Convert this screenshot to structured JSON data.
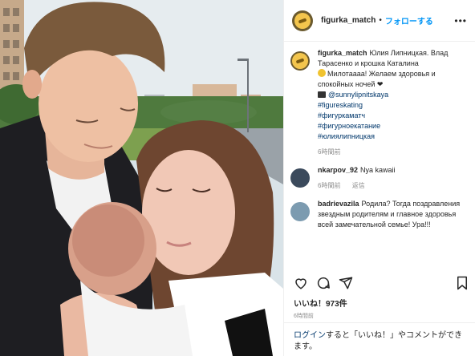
{
  "post": {
    "username": "figurka_match",
    "separator": "•",
    "follow_label": "フォローする",
    "more_label": "•••"
  },
  "caption": {
    "username": "figurka_match",
    "line1": "Юлия Липницкая. Влад Тарасенко и крошка Каталина",
    "line2": "Милотаааа! Желаем здоровья и спокойных ночей ❤",
    "mention": "@sunnylipnitskaya",
    "hashtags": [
      "#figureskating",
      "#фигуркаматч",
      "#фигурноекатание",
      "#юлиялипницкая"
    ],
    "time": "6時間前"
  },
  "comments": [
    {
      "username": "nkarpov_92",
      "text": "Nya kawaii",
      "time": "6時間前",
      "reply_label": "返信",
      "avatar_color": "#3b4a5c"
    },
    {
      "username": "badrievazila",
      "text": "Родила? Тогда поздравления звездным родителям и главное здоровья всей замечательной семье! Ура!!!",
      "avatar_color": "#7c9bb0"
    }
  ],
  "actions": {
    "like_icon": "heart-icon",
    "comment_icon": "comment-icon",
    "share_icon": "share-icon",
    "save_icon": "bookmark-icon"
  },
  "likes_text": "いいね！973件",
  "post_time": "6時間前",
  "login_prompt": {
    "link": "ログイン",
    "rest": "すると「いいね！」やコメントができます。"
  },
  "colors": {
    "link_blue": "#0095f6",
    "tag_blue": "#00376b",
    "muted": "#8e8e8e"
  }
}
